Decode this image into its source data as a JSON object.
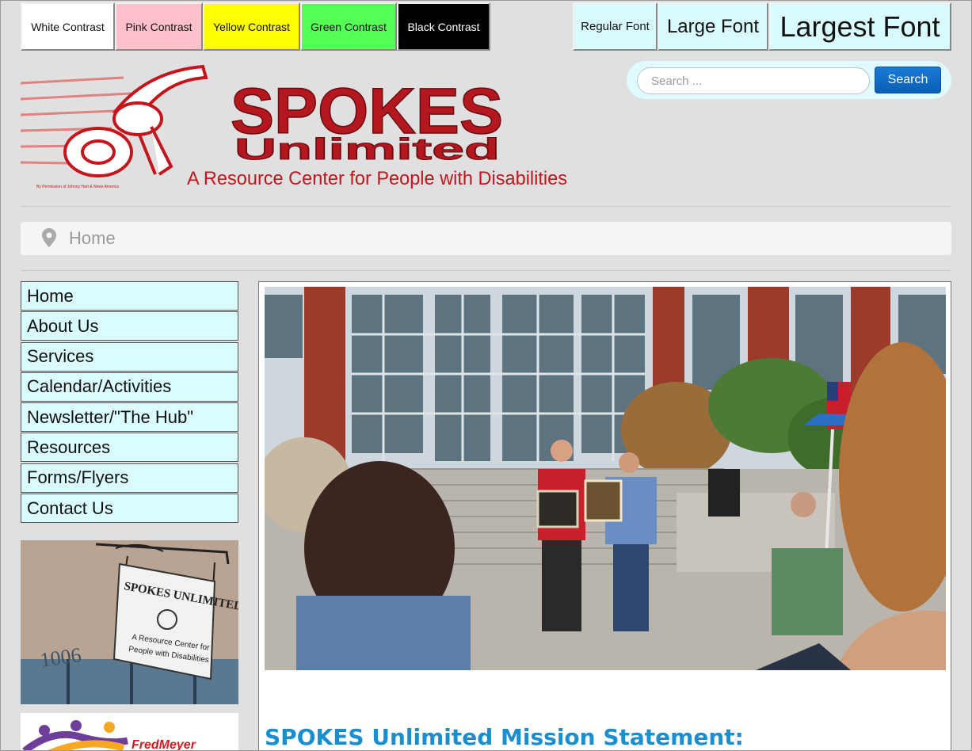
{
  "contrast_buttons": [
    {
      "label": "White Contrast",
      "bg": "#ffffff",
      "fg": "#111111"
    },
    {
      "label": "Pink Contrast",
      "bg": "#ffc0cb",
      "fg": "#111111"
    },
    {
      "label": "Yellow Contrast",
      "bg": "#ffff00",
      "fg": "#111111"
    },
    {
      "label": "Green Contrast",
      "bg": "#55ff55",
      "fg": "#111111"
    },
    {
      "label": "Black Contrast",
      "bg": "#000000",
      "fg": "#ffffff"
    }
  ],
  "font_buttons": [
    {
      "label": "Regular Font"
    },
    {
      "label": "Large Font"
    },
    {
      "label": "Largest Font"
    }
  ],
  "logo": {
    "line1": "SPOKES",
    "line2": "Unlimited",
    "tagline": "A Resource Center for People with Disabilities",
    "credit": "By Permission of Johnny Hart & News America"
  },
  "search": {
    "placeholder": "Search ...",
    "button": "Search"
  },
  "breadcrumb": {
    "current": "Home"
  },
  "menu": [
    "Home",
    "About Us",
    "Services",
    "Calendar/Activities",
    "Newsletter/\"The Hub\"",
    "Resources",
    "Forms/Flyers",
    "Contact Us"
  ],
  "sidebar_sign": {
    "line1": "SPOKES UNLIMITED",
    "line2": "A Resource Center for",
    "line3": "People with Disabilities",
    "number": "1006"
  },
  "sponsor": {
    "name": "FredMeyer"
  },
  "content": {
    "heading": "SPOKES Unlimited Mission Statement:"
  },
  "colors": {
    "brand_red": "#b5171e",
    "accent_blue": "#1a8fd0",
    "menu_bg": "#dafcfd"
  }
}
